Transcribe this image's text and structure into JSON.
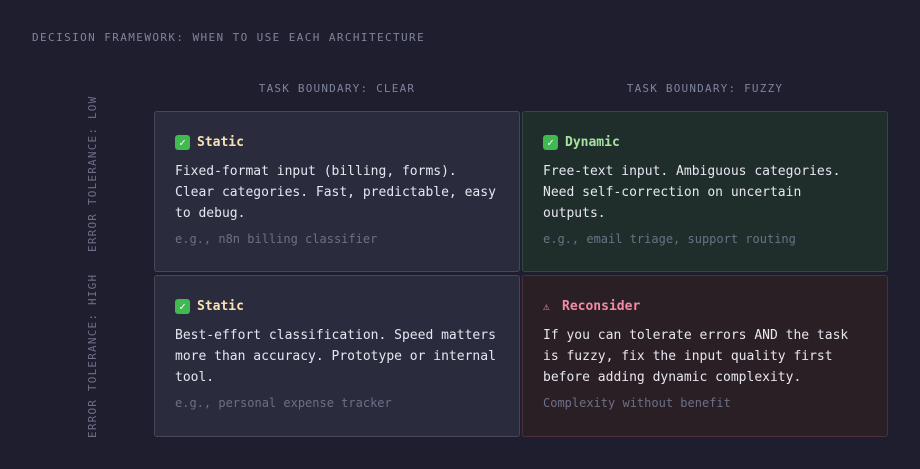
{
  "title": "DECISION FRAMEWORK: WHEN TO USE EACH ARCHITECTURE",
  "columns": {
    "clear": "TASK BOUNDARY: CLEAR",
    "fuzzy": "TASK BOUNDARY: FUZZY"
  },
  "rows": {
    "low": "ERROR TOLERANCE: LOW",
    "high": "ERROR TOLERANCE: HIGH"
  },
  "cells": {
    "low_clear": {
      "icon": "✓",
      "title": "Static",
      "body": "Fixed-format input (billing, forms). Clear categories. Fast, predictable, easy to debug.",
      "example": "e.g., n8n billing classifier"
    },
    "low_fuzzy": {
      "icon": "✓",
      "title": "Dynamic",
      "body": "Free-text input. Ambiguous categories. Need self-correction on uncertain outputs.",
      "example": "e.g., email triage, support routing"
    },
    "high_clear": {
      "icon": "✓",
      "title": "Static",
      "body": "Best-effort classification. Speed matters more than accuracy. Prototype or internal tool.",
      "example": "e.g., personal expense tracker"
    },
    "high_fuzzy": {
      "icon": "⚠",
      "title": "Reconsider",
      "body": "If you can tolerate errors AND the task is fuzzy, fix the input quality first before adding dynamic complexity.",
      "example": "Complexity without benefit"
    }
  },
  "colors": {
    "background": "#1e1e2e",
    "static_title": "#f9e2af",
    "dynamic_title": "#a6e3a1",
    "reconsider_title": "#f38ba8",
    "check_badge": "#3fb950"
  }
}
